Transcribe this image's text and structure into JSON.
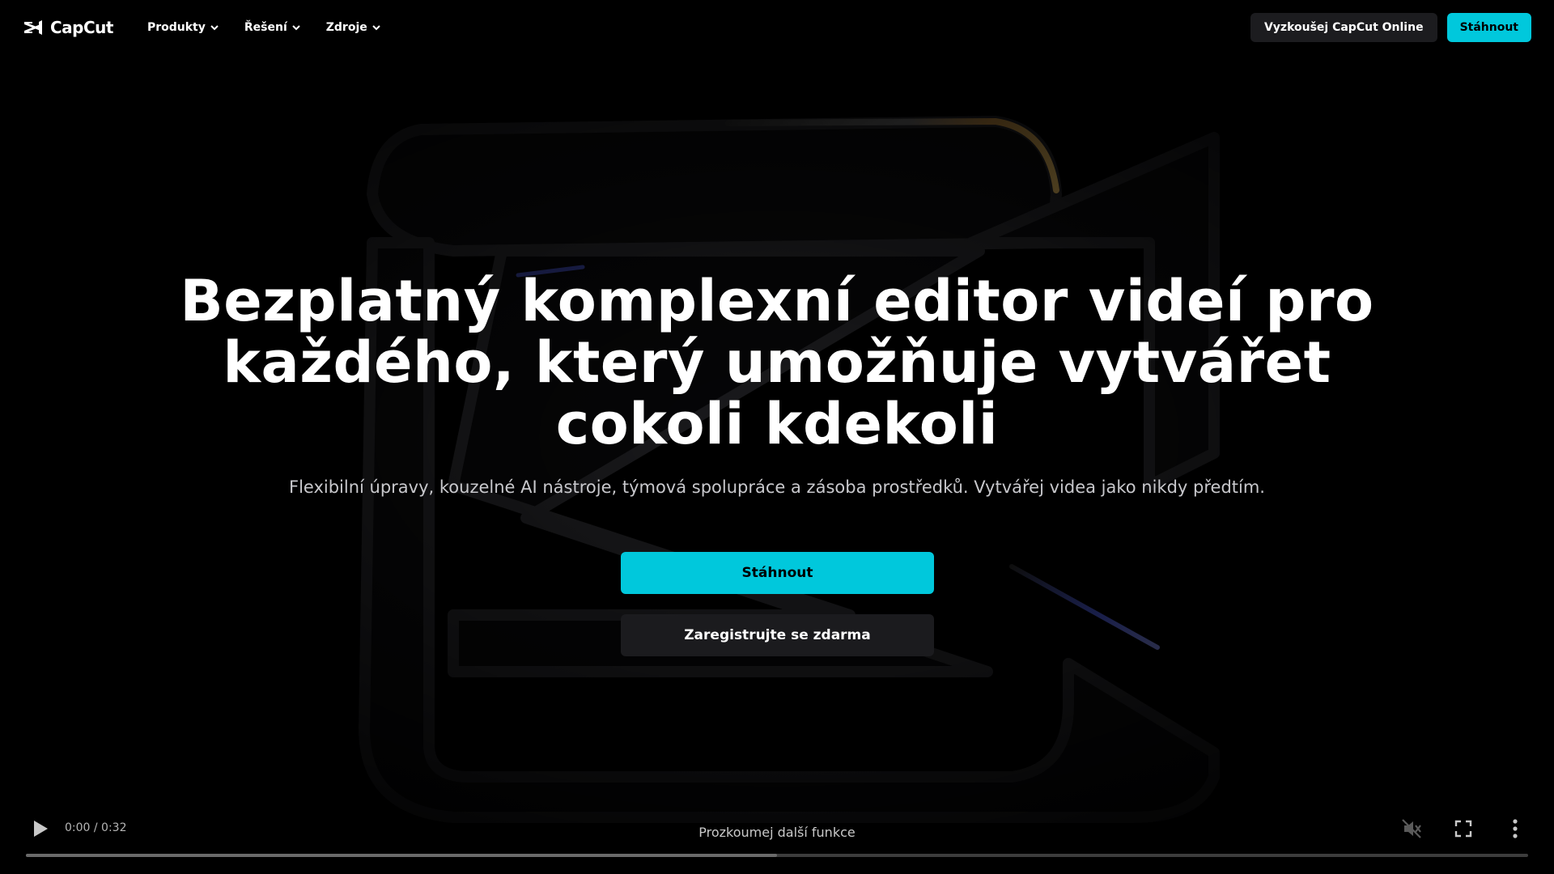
{
  "brand": {
    "name": "CapCut"
  },
  "nav": {
    "items": [
      {
        "label": "Produkty"
      },
      {
        "label": "Řešení"
      },
      {
        "label": "Zdroje"
      }
    ],
    "try_online_label": "Vyzkoušej CapCut Online",
    "download_label": "Stáhnout"
  },
  "hero": {
    "title": "Bezplatný komplexní editor videí pro každého, který umožňuje vytvářet cokoli kdekoli",
    "subtitle": "Flexibilní úpravy, kouzelné AI nástroje, týmová spolupráce a zásoba prostředků. Vytvářej videa jako nikdy předtím.",
    "download_label": "Stáhnout",
    "register_label": "Zaregistrujte se zdarma"
  },
  "video": {
    "time": "0:00 / 0:32",
    "explore_label": "Prozkoumej další funkce",
    "progress": 0.5,
    "muted": true
  },
  "colors": {
    "accent": "#00c8dc",
    "background": "#000000",
    "secondary_button": "#1c1c1f"
  },
  "icons": {
    "logo": "capcut-logo-icon",
    "dropdown": "chevron-down-icon",
    "play": "play-icon",
    "mute": "volume-muted-icon",
    "fullscreen": "fullscreen-icon",
    "more": "more-vertical-icon"
  }
}
